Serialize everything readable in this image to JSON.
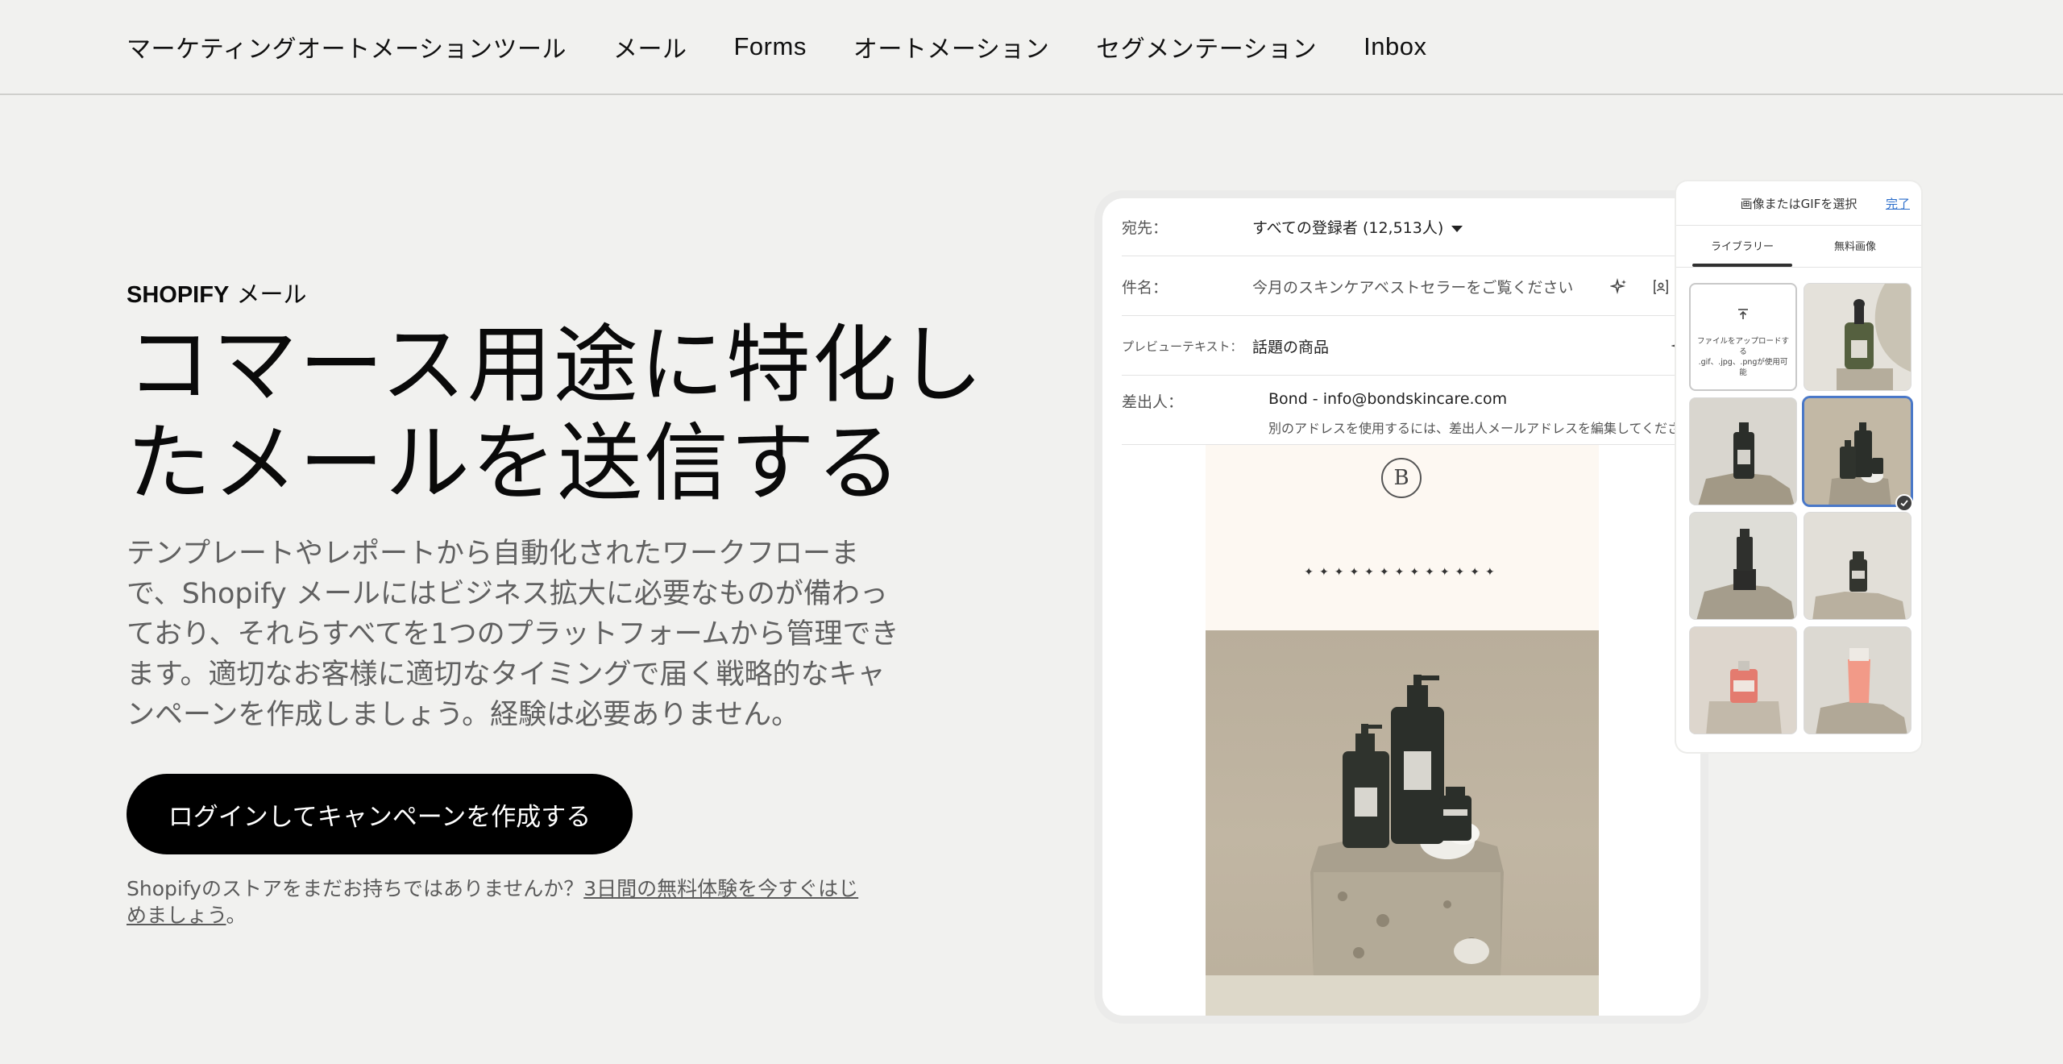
{
  "nav": {
    "items": [
      {
        "label": "マーケティングオートメーションツール"
      },
      {
        "label": "メール"
      },
      {
        "label": "Forms"
      },
      {
        "label": "オートメーション"
      },
      {
        "label": "セグメンテーション"
      },
      {
        "label": "Inbox"
      }
    ]
  },
  "hero": {
    "eyebrow_brand": "SHOPIFY",
    "eyebrow_suffix": " メール",
    "headline_line1": "コマース用途に特化し",
    "headline_line2": "たメールを送信する",
    "lead": "テンプレートやレポートから自動化されたワークフローまで、Shopify メールにはビジネス拡大に必要なものが備わっており、それらすべてを1つのプラットフォームから管理できます。適切なお客様に適切なタイミングで届く戦略的なキャンペーンを作成しましょう。経験は必要ありません。",
    "cta_label": "ログインしてキャンペーンを作成する",
    "trial_prefix": "Shopifyのストアをまだお持ちではありませんか？",
    "trial_link": "3日間の無料体験を今すぐはじめましょう",
    "trial_suffix": "。"
  },
  "editor": {
    "to_label": "宛先：",
    "to_value": "すべての登録者 (12,513人)",
    "subject_label": "件名：",
    "subject_value": "今月のスキンケアベストセラーをご覧ください",
    "preview_label": "プレビューテキスト：",
    "preview_value": "話題の商品",
    "from_label": "差出人：",
    "from_value": "Bond - info@bondskincare.com",
    "from_note": "別のアドレスを使用するには、差出人メールアドレスを編集してください",
    "brand_letter": "B",
    "sparkles": "✦✦✦✦✦✦✦✦✦✦✦✦✦"
  },
  "picker": {
    "title": "画像またはGIFを選択",
    "done_label": "完了",
    "tabs": [
      {
        "label": "ライブラリー"
      },
      {
        "label": "無料画像"
      }
    ],
    "upload_title": "ファイルをアップロードする",
    "upload_hint": ".gif、.jpg、.pngが使用可能",
    "selected_tile": 3
  },
  "colors": {
    "background": "#f1f1ef",
    "cta_bg": "#000000",
    "accent_link": "#2c6ecb",
    "selected_border": "#4a78c8"
  },
  "icons": {
    "sparkle": "magic-sparkle-icon",
    "personalize": "personalize-icon",
    "upload": "upload-arrow-icon",
    "check": "check-icon",
    "dropdown": "caret-down-icon"
  }
}
